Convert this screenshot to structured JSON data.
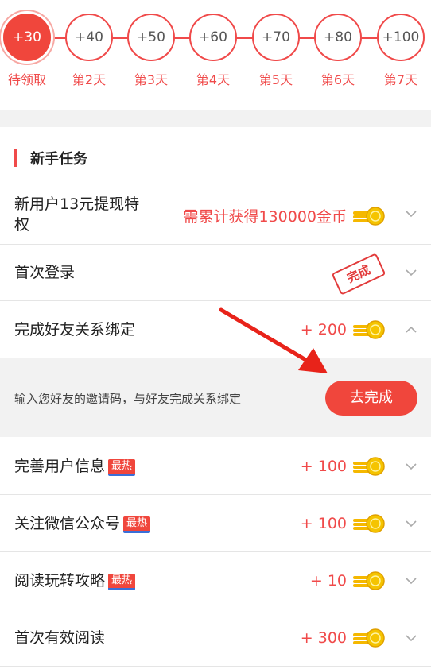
{
  "checkin": {
    "days": [
      {
        "points": "+30",
        "label": "待领取",
        "active": true
      },
      {
        "points": "+40",
        "label": "第2天"
      },
      {
        "points": "+50",
        "label": "第3天"
      },
      {
        "points": "+60",
        "label": "第4天"
      },
      {
        "points": "+70",
        "label": "第5天"
      },
      {
        "points": "+80",
        "label": "第6天"
      },
      {
        "points": "+100",
        "label": "第7天"
      }
    ]
  },
  "section": {
    "title": "新手任务"
  },
  "tasks": [
    {
      "title_line1": "新用户13元提现特",
      "title_line2": "权",
      "reward": "需累计获得130000金币",
      "icon": "coin-stack-icon",
      "chevron": "down"
    },
    {
      "title": "首次登录",
      "stamp": "完成",
      "chevron": "down"
    },
    {
      "title": "完成好友关系绑定",
      "reward": "+ 200",
      "icon": "coin-stack-icon",
      "chevron": "up"
    },
    {
      "title": "完善用户信息",
      "badge": "最热",
      "reward": "+ 100",
      "icon": "coin-stack-icon",
      "chevron": "down"
    },
    {
      "title": "关注微信公众号",
      "badge": "最热",
      "reward": "+ 100",
      "icon": "coin-stack-icon",
      "chevron": "down"
    },
    {
      "title": "阅读玩转攻略",
      "badge": "最热",
      "reward": "+ 10",
      "icon": "coin-stack-icon",
      "chevron": "down"
    },
    {
      "title": "首次有效阅读",
      "reward": "+ 300",
      "icon": "coin-stack-icon",
      "chevron": "down"
    }
  ],
  "detail": {
    "text": "输入您好友的邀请码，与好友完成关系绑定",
    "button_label": "去完成"
  },
  "colors": {
    "accent": "#f0463c",
    "coin": "#f5b800",
    "badge_underline": "#3a6fd8",
    "background_gray": "#f2f2f2"
  }
}
